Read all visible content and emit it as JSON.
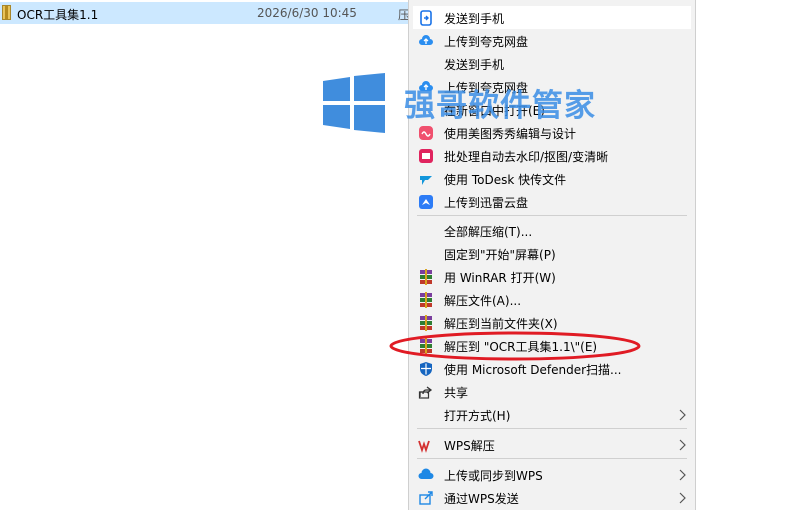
{
  "file": {
    "name": "OCR工具集1.1",
    "date": "2026/6/30 10:45",
    "type_cut": "压"
  },
  "watermark": {
    "text": "强哥软件管家"
  },
  "menu": {
    "items": [
      {
        "label": "发送到手机",
        "icon": "phone-send-icon"
      },
      {
        "label": "上传到夸克网盘",
        "icon": "quark-cloud-icon"
      },
      {
        "label": "发送到手机",
        "icon": ""
      },
      {
        "label": "上传到夸克网盘",
        "icon": "quark-cloud-icon"
      },
      {
        "label": "在新窗口中打开(E)",
        "icon": ""
      },
      {
        "label": "使用美图秀秀编辑与设计",
        "icon": "meitu-icon"
      },
      {
        "label": "批处理自动去水印/抠图/变清晰",
        "icon": "batch-icon"
      },
      {
        "label": "使用 ToDesk 快传文件",
        "icon": "todesk-icon"
      },
      {
        "label": "上传到迅雷云盘",
        "icon": "xunlei-icon"
      },
      {
        "label": "全部解压缩(T)...",
        "icon": ""
      },
      {
        "label": "固定到\"开始\"屏幕(P)",
        "icon": ""
      },
      {
        "label": "用 WinRAR 打开(W)",
        "icon": "winrar-icon"
      },
      {
        "label": "解压文件(A)...",
        "icon": "winrar-icon"
      },
      {
        "label": "解压到当前文件夹(X)",
        "icon": "winrar-icon"
      },
      {
        "label": "解压到 \"OCR工具集1.1\\\"(E)",
        "icon": "winrar-icon"
      },
      {
        "label": "使用 Microsoft Defender扫描...",
        "icon": "defender-icon"
      },
      {
        "label": "共享",
        "icon": "share-icon"
      },
      {
        "label": "打开方式(H)",
        "icon": ""
      },
      {
        "label": "WPS解压",
        "icon": "wps-icon"
      },
      {
        "label": "上传或同步到WPS",
        "icon": "wps-cloud-icon"
      },
      {
        "label": "通过WPS发送",
        "icon": "wps-send-icon"
      }
    ]
  },
  "colors": {
    "selection": "#cce8ff",
    "menu_bg": "#f2f2f2",
    "annotation": "#e01b24",
    "watermark": "#3a8ee6"
  }
}
